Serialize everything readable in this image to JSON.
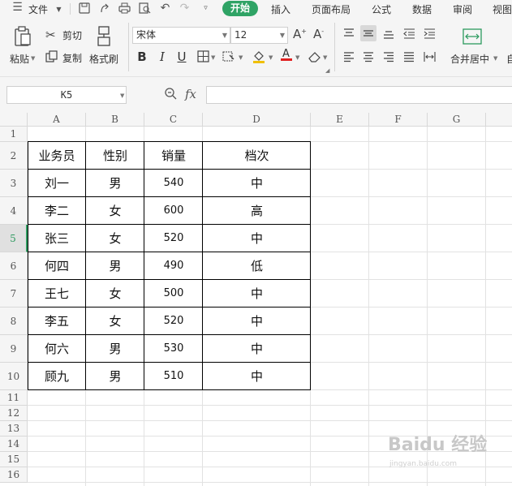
{
  "menu": {
    "file": "文件",
    "tabs": [
      "开始",
      "插入",
      "页面布局",
      "公式",
      "数据",
      "审阅",
      "视图"
    ]
  },
  "ribbon": {
    "paste": "粘贴",
    "cut": "剪切",
    "copy": "复制",
    "format_painter": "格式刷",
    "font_name": "宋体",
    "font_size": "12",
    "merge_center": "合并居中",
    "auto_wrap_partial": "自"
  },
  "formula_bar": {
    "name_box": "K5",
    "fx": "fx",
    "formula": ""
  },
  "sheet": {
    "columns": [
      "A",
      "B",
      "C",
      "D",
      "E",
      "F",
      "G"
    ],
    "rows": [
      "1",
      "2",
      "3",
      "4",
      "5",
      "6",
      "7",
      "8",
      "9",
      "10",
      "11",
      "12",
      "13",
      "14",
      "15",
      "16"
    ],
    "active_row": "5",
    "header": [
      "业务员",
      "性别",
      "销量",
      "档次"
    ],
    "data": [
      [
        "刘一",
        "男",
        "540",
        "中"
      ],
      [
        "李二",
        "女",
        "600",
        "高"
      ],
      [
        "张三",
        "女",
        "520",
        "中"
      ],
      [
        "何四",
        "男",
        "490",
        "低"
      ],
      [
        "王七",
        "女",
        "500",
        "中"
      ],
      [
        "李五",
        "女",
        "520",
        "中"
      ],
      [
        "何六",
        "男",
        "530",
        "中"
      ],
      [
        "顾九",
        "男",
        "510",
        "中"
      ]
    ]
  },
  "watermark": {
    "text": "Baidu 经验",
    "url": "jingyan.baidu.com"
  },
  "colors": {
    "accent": "#2fa365",
    "active_row": "#2f9a60"
  }
}
